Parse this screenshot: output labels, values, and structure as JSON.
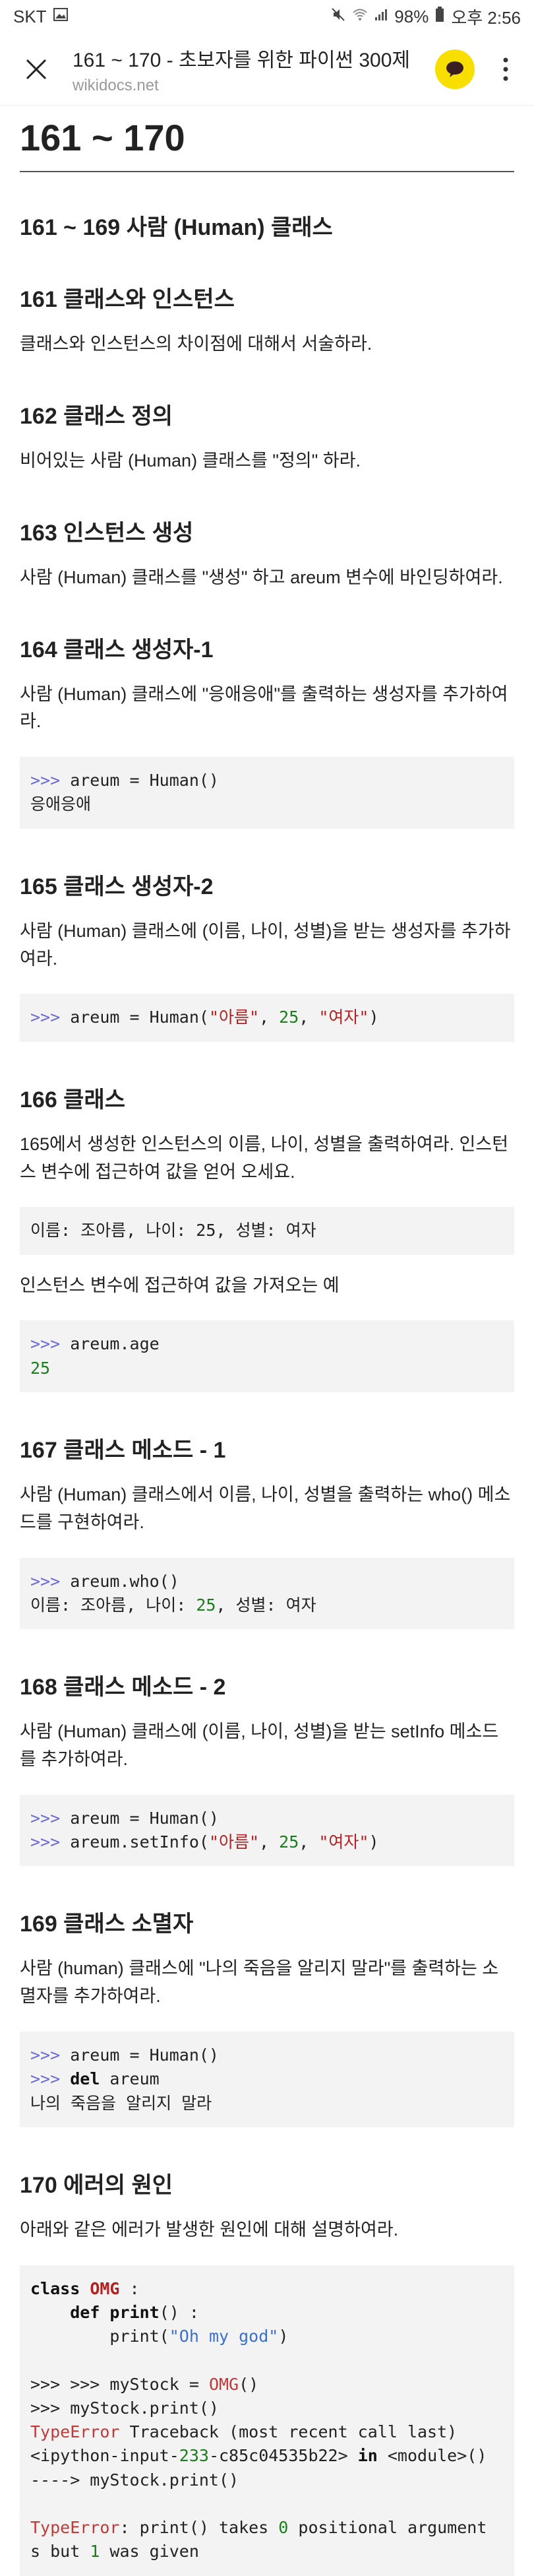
{
  "status": {
    "carrier": "SKT",
    "battery": "98%",
    "time": "오후 2:56"
  },
  "browser": {
    "title": "161 ~ 170 - 초보자를 위한 파이썬 300제",
    "url": "wikidocs.net"
  },
  "page": {
    "heading": "161 ~ 170",
    "section": "161 ~ 169 사람 (Human) 클래스",
    "q161": {
      "title": "161 클래스와 인스턴스",
      "desc": "클래스와 인스턴스의 차이점에 대해서 서술하라."
    },
    "q162": {
      "title": "162 클래스 정의",
      "desc": "비어있는 사람 (Human) 클래스를 \"정의\" 하라."
    },
    "q163": {
      "title": "163 인스턴스 생성",
      "desc": "사람 (Human) 클래스를 \"생성\" 하고 areum 변수에 바인딩하여라."
    },
    "q164": {
      "title": "164 클래스 생성자-1",
      "desc": "사람 (Human) 클래스에 \"응애응애\"를 출력하는 생성자를 추가하여라.",
      "code_prompt": ">>>",
      "code_line": " areum = Human()",
      "output": "응애응애"
    },
    "q165": {
      "title": "165 클래스 생성자-2",
      "desc": "사람 (Human) 클래스에 (이름, 나이, 성별)을 받는 생성자를 추가하여라.",
      "prompt": ">>>",
      "pre": " areum = Human(",
      "s1": "\"아름\"",
      "c1": ", ",
      "n1": "25",
      "c2": ", ",
      "s2": "\"여자\"",
      "post": ")"
    },
    "q166": {
      "title": "166 클래스",
      "desc": "165에서 생성한 인스턴스의 이름, 나이, 성별을 출력하여라. 인스턴스 변수에 접근하여 값을 얻어 오세요.",
      "output": "이름: 조아름, 나이: 25, 성별: 여자",
      "desc2": "인스턴스 변수에 접근하여 값을 가져오는 예",
      "prompt": ">>>",
      "code_line": " areum.age",
      "result": "25"
    },
    "q167": {
      "title": "167 클래스 메소드 - 1",
      "desc": "사람 (Human) 클래스에서 이름, 나이, 성별을 출력하는 who() 메소드를 구현하여라.",
      "prompt": ">>>",
      "code_line": " areum.who()",
      "out_pre": "이름: 조아름, 나이: ",
      "out_num": "25",
      "out_post": ", 성별: 여자"
    },
    "q168": {
      "title": "168 클래스 메소드 - 2",
      "desc": "사람 (Human) 클래스에 (이름, 나이, 성별)을 받는 setInfo 메소드를 추가하여라.",
      "prompt": ">>>",
      "line1": " areum = Human()",
      "line2_pre": " areum.setInfo(",
      "s1": "\"아름\"",
      "c1": ", ",
      "n1": "25",
      "c2": ", ",
      "s2": "\"여자\"",
      "post": ")"
    },
    "q169": {
      "title": "169 클래스 소멸자",
      "desc": "사람 (human) 클래스에 \"나의 죽음을 알리지 말라\"를 출력하는 소멸자를 추가하여라.",
      "prompt": ">>>",
      "line1": " areum = Human()",
      "kw_del": "del",
      "line2_post": " areum",
      "output": "나의 죽음을 알리지 말라"
    },
    "q170": {
      "title": "170 에러의 원인",
      "desc": "아래와 같은 에러가 발생한 원인에 대해 설명하여라.",
      "kw_class": "class",
      "cls_name": "OMG",
      "colon1": " :",
      "indent1": "    ",
      "kw_def": "def",
      "fn_name": " print",
      "fn_sig": "() :",
      "indent2": "        ",
      "print_call": "print(",
      "print_str": "\"Oh my god\"",
      "print_end": ")",
      "l5_pre": ">>> >>> myStock = ",
      "l5_cls": "OMG",
      "l5_post": "()",
      "l6": ">>> myStock.print()",
      "l7_err": "TypeError",
      "l7_post": " Traceback (most recent call last)",
      "l8_pre": "<ipython-input-",
      "l8_num": "233",
      "l8_mid": "-c85c04535b22> ",
      "l8_in": "in",
      "l8_post": " <module>()",
      "l9": "----> myStock.print()",
      "l11_err": "TypeError",
      "l11_a": ": print() takes ",
      "l11_n0": "0",
      "l11_b": " positional argument",
      "l12_a": "s but ",
      "l12_n1": "1",
      "l12_b": " was given"
    }
  }
}
